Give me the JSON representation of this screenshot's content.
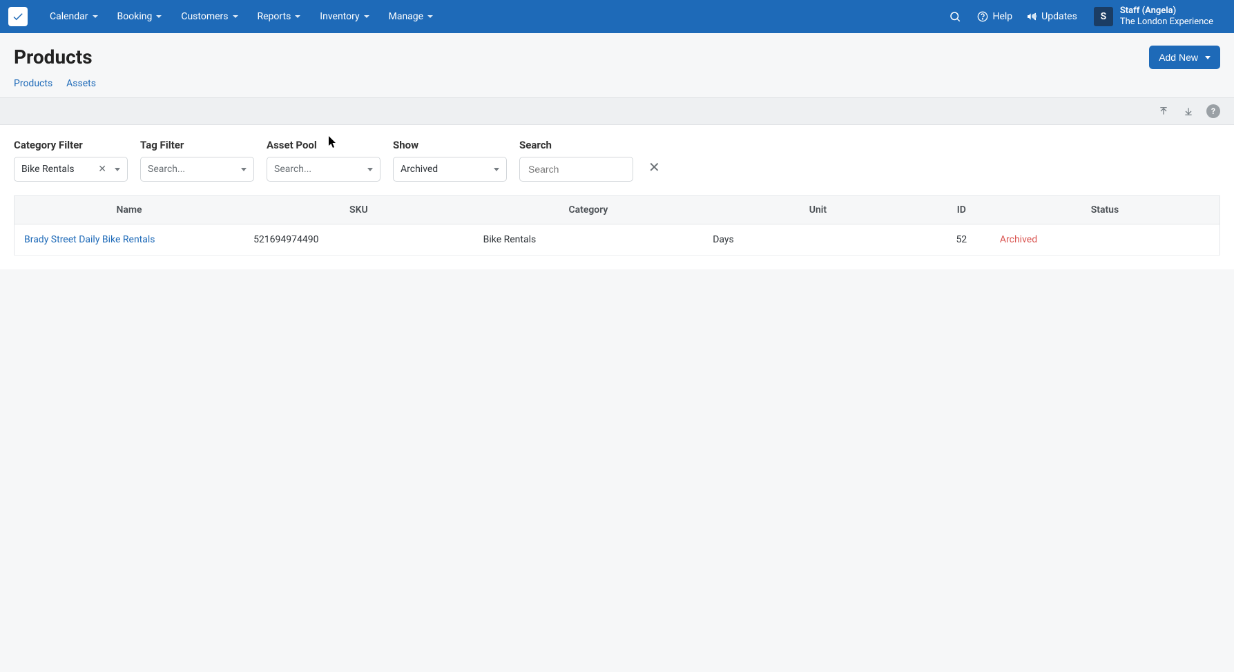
{
  "nav": {
    "items": [
      "Calendar",
      "Booking",
      "Customers",
      "Reports",
      "Inventory",
      "Manage"
    ],
    "help": "Help",
    "updates": "Updates",
    "user": {
      "badge": "S",
      "name": "Staff (Angela)",
      "org": "The London Experience"
    }
  },
  "page": {
    "title": "Products",
    "tabs": [
      "Products",
      "Assets"
    ],
    "add_button": "Add New"
  },
  "filters": {
    "category": {
      "label": "Category Filter",
      "value": "Bike Rentals"
    },
    "tag": {
      "label": "Tag Filter",
      "placeholder": "Search..."
    },
    "asset": {
      "label": "Asset Pool",
      "placeholder": "Search..."
    },
    "show": {
      "label": "Show",
      "value": "Archived"
    },
    "search": {
      "label": "Search",
      "placeholder": "Search"
    }
  },
  "table": {
    "headers": [
      "Name",
      "SKU",
      "Category",
      "Unit",
      "ID",
      "Status"
    ],
    "rows": [
      {
        "name": "Brady Street Daily Bike Rentals",
        "sku": "521694974490",
        "category": "Bike Rentals",
        "unit": "Days",
        "id": "52",
        "status": "Archived"
      }
    ]
  }
}
